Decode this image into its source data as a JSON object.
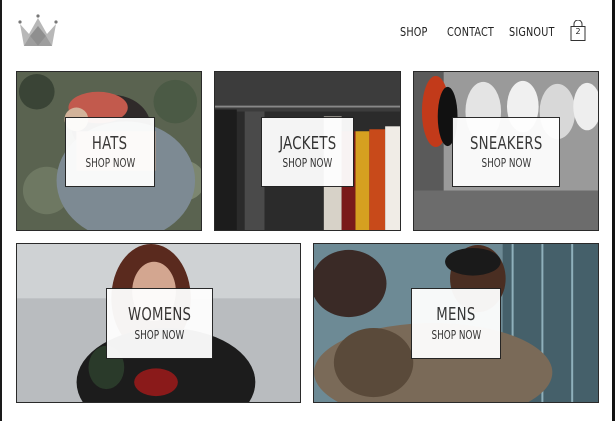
{
  "header": {
    "logo_icon": "crown-icon",
    "nav": [
      "SHOP",
      "CONTACT",
      "SIGNOUT"
    ],
    "cart_icon": "shopping-bag-icon",
    "cart_count": "2"
  },
  "categories": [
    {
      "title": "HATS",
      "subtitle": "SHOP NOW"
    },
    {
      "title": "JACKETS",
      "subtitle": "SHOP NOW"
    },
    {
      "title": "SNEAKERS",
      "subtitle": "SHOP NOW"
    },
    {
      "title": "WOMENS",
      "subtitle": "SHOP NOW"
    },
    {
      "title": "MENS",
      "subtitle": "SHOP NOW"
    }
  ]
}
